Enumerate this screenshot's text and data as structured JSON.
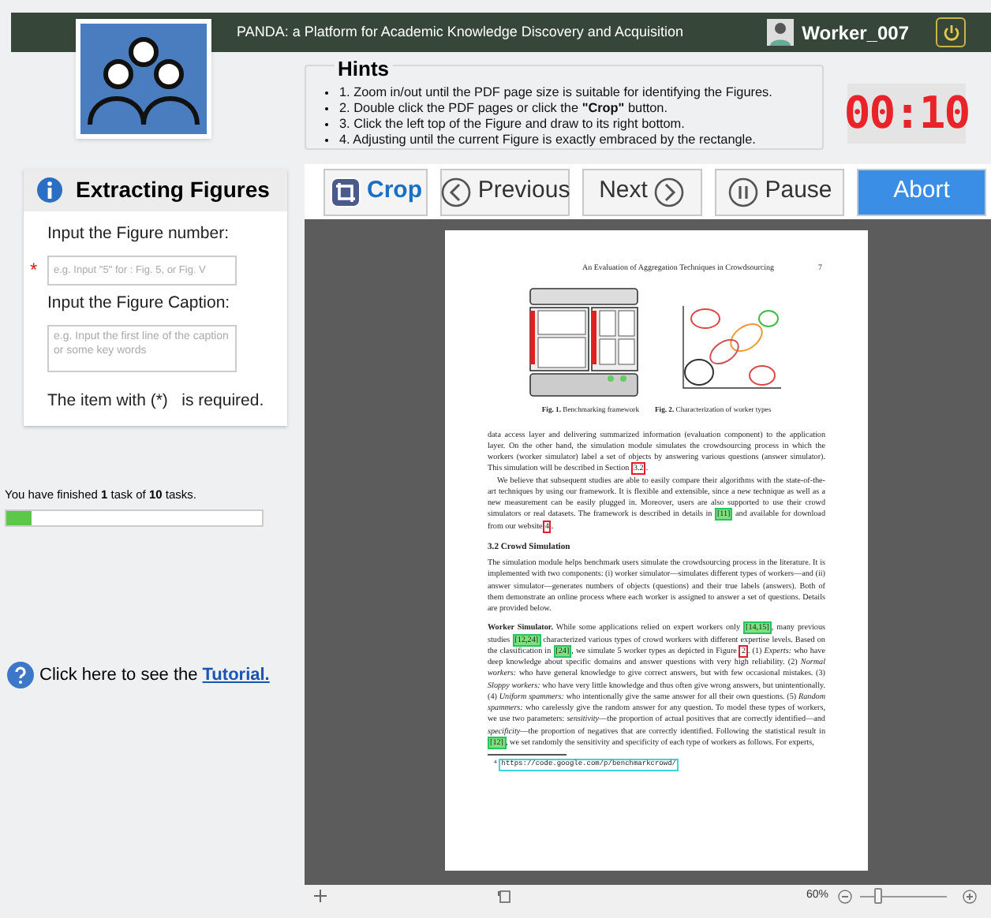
{
  "header": {
    "title": "PANDA: a Platform for Academic Knowledge Discovery and Acquisition",
    "user": "Worker_007"
  },
  "hints": {
    "title": "Hints",
    "items": [
      {
        "text": "1.  Zoom in/out until the PDF page size is suitable for identifying the Figures."
      },
      {
        "text": "2. Double click the PDF pages or click the **\"Crop\"** button."
      },
      {
        "text": "3. Click the left top of the Figure and draw to its right bottom."
      },
      {
        "text": "4. Adjusting until the current Figure is exactly embraced by the rectangle."
      }
    ]
  },
  "timer": "00:10",
  "panel": {
    "title": "Extracting Figures",
    "number_label": "Input the Figure number:",
    "required_mark": "*",
    "number_placeholder": "e.g. Input \"5\" for : Fig. 5, or Fig. V",
    "caption_label": "Input the Figure Caption:",
    "caption_placeholder": "e.g. Input the first line of the caption or some key words",
    "note": "The item with (*)   is required."
  },
  "progress": {
    "text": "You have finished **1** task of **10** tasks.",
    "level": 0.1
  },
  "tutorial": {
    "text": "Click here to see the ",
    "link": "Tutorial."
  },
  "toolbar": [
    {
      "kind": "crop",
      "label": "Crop"
    },
    {
      "kind": "previous",
      "label": "Previous"
    },
    {
      "kind": "next",
      "label": "Next"
    },
    {
      "kind": "pause",
      "label": "Pause"
    },
    {
      "kind": "abort",
      "label": "Abort"
    }
  ],
  "pdf": {
    "running_title": "An Evaluation of Aggregation Techniques in Crowdsourcing",
    "page_number": "7",
    "captions": [
      "**Fig. 1.** Benchmarking framework",
      "**Fig. 2.** Characterization of worker types"
    ],
    "blocks": [
      {
        "kind": "paragraph",
        "indent": false,
        "segments": [
          {
            "text": "data access layer and delivering summarized information (evaluation component) to the application layer. On the other hand, the simulation module simulates the crowdsourcing process in which the workers (worker simulator) label a set of objects by answering various questions (answer simulator). This simulation will be described in Section "
          },
          {
            "text": "3.2",
            "color": "#e11d2a"
          },
          {
            "text": "."
          }
        ]
      },
      {
        "kind": "paragraph",
        "indent": true,
        "segments": [
          {
            "text": "We believe that subsequent studies are able to easily compare their algorithms with the state-of-the-art techniques by using our framework. It is flexible and extensible, since a new technique as well as a new measurement can be easily plugged in. Moreover, users are also supported to use their crowd simulators or real datasets. The framework is described in details in "
          },
          {
            "text": "[11]",
            "color": "#22c55e"
          },
          {
            "text": " and available for download from our website"
          },
          {
            "text": "4",
            "color": "#e11d2a"
          },
          {
            "text": "."
          }
        ]
      },
      {
        "kind": "heading",
        "segments": [
          {
            "text": "3.2   Crowd Simulation"
          }
        ]
      },
      {
        "kind": "paragraph",
        "indent": false,
        "segments": [
          {
            "text": "The simulation module helps benchmark users simulate the crowdsourcing process in the literature. It is implemented with two components: (i) worker simulator—simulates different types of workers—and (ii) answer simulator—generates numbers of objects (questions) and their true labels (answers). Both of them demonstrate an online process where each worker is assigned to answer a set of questions. Details are provided below."
          }
        ]
      },
      {
        "kind": "paragraph",
        "indent": false,
        "segments": [
          {
            "text": "**Worker Simulator.** While some applications relied on expert workers only "
          },
          {
            "text": "[14,15]",
            "color": "#22c55e"
          },
          {
            "text": ", many previous studies "
          },
          {
            "text": "[12,24]",
            "color": "#22c55e"
          },
          {
            "text": " characterized various types of crowd workers with different expertise levels. Based on the classification in "
          },
          {
            "text": "[24]",
            "color": "#22c55e"
          },
          {
            "text": ", we simulate 5 worker types as depicted in Figure "
          },
          {
            "text": "2",
            "color": "#e11d2a"
          },
          {
            "text": ". (1) *Experts:* who have deep knowledge about specific domains and answer questions with very high reliability. (2) *Normal workers:* who have general knowledge to give correct answers, but with few occasional mistakes. (3) *Sloppy workers:* who have very little knowledge and thus often give wrong answers, but unintentionally. (4) *Uniform spammers:* who intentionally give the same answer for all their own questions. (5) *Random spammers:* who carelessly give the random answer for any question. To model these types of workers, we use two parameters: *sensitivity*—the proportion of actual positives that are correctly identified—and *specificity*—the proportion of negatives that are correctly identified. Following the statistical result in "
          },
          {
            "text": "[12]",
            "color": "#22c55e"
          },
          {
            "text": ", we set randomly the sensitivity and specificity of each type of workers as follows. For experts,"
          }
        ]
      }
    ],
    "footnote": {
      "mark": "4",
      "url": "https://code.google.com/p/benchmarkcrowd/"
    }
  },
  "status_bar": {
    "zoom": "60%",
    "level": 0.2
  }
}
